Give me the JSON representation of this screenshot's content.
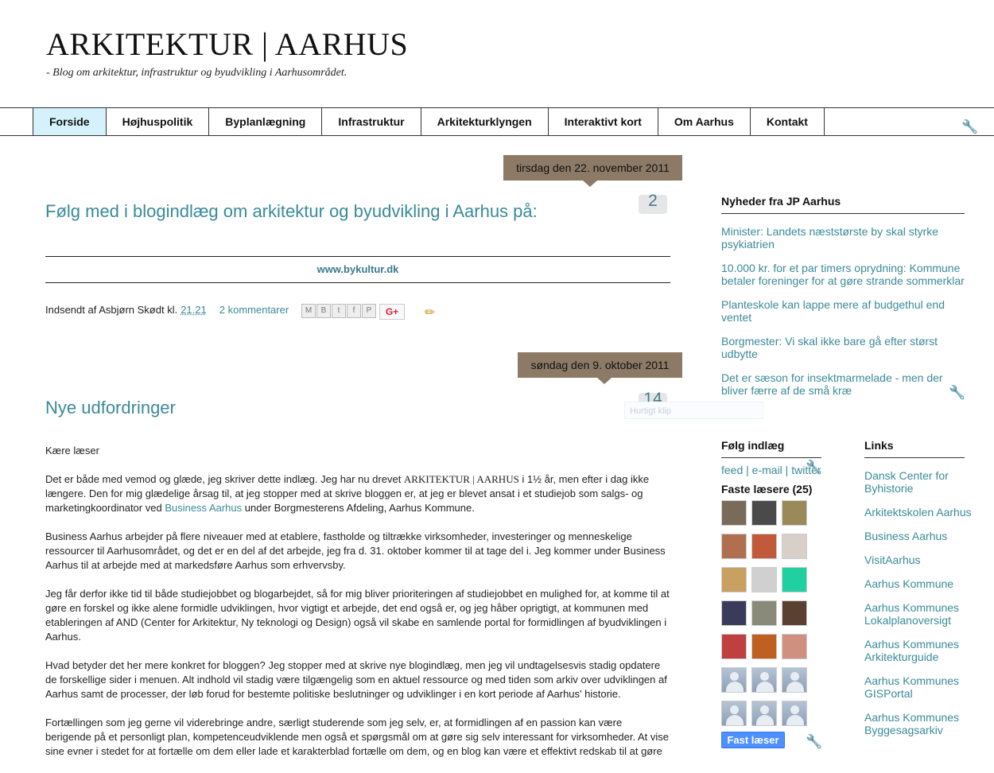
{
  "blog": {
    "title": "ARKITEKTUR | AARHUS",
    "description": "- Blog om arkitektur, infrastruktur og byudvikling i Aarhusområdet."
  },
  "nav": {
    "tabs": [
      "Forside",
      "Højhuspolitik",
      "Byplanlægning",
      "Infrastruktur",
      "Arkitekturklyngen",
      "Interaktivt kort",
      "Om Aarhus",
      "Kontakt"
    ],
    "active": "Forside"
  },
  "posts": [
    {
      "date": "tirsdag den 22. november 2011",
      "title": "Følg med i blogindlæg om arkitektur og byudvikling i Aarhus på:",
      "comment_count": "2",
      "link_text": "www.bykultur.dk",
      "author_prefix": "Indsendt af Asbjørn Skødt kl.",
      "time": "21.21",
      "comments_label": "2 kommentarer",
      "share_buttons": [
        "M",
        "B",
        "t",
        "f",
        "P"
      ],
      "gplus_label": "G+"
    },
    {
      "date": "søndag den 9. oktober 2011",
      "title": "Nye udfordringer",
      "comment_count": "14",
      "faint_label": "Hurtigt klip",
      "body": {
        "greeting": "Kære læser",
        "p1_a": "Det er både med vemod og glæde, jeg skriver dette indlæg. Jeg har nu drevet ",
        "p1_brand": "ARKITEKTUR | AARHUS",
        "p1_b": " i 1½ år, men efter i dag ikke længere. Den for mig glædelige årsag til, at jeg stopper med at skrive bloggen er, at jeg er blevet ansat i et studiejob som salgs- og marketingkoordinator ved ",
        "p1_link": "Business Aarhus",
        "p1_c": " under Borgmesterens Afdeling, Aarhus Kommune.",
        "p2": "Business Aarhus arbejder på flere niveauer med at etablere, fastholde og tiltrække virksomheder, investeringer og menneskelige ressourcer til Aarhusområdet, og det er en del af det arbejde, jeg fra d. 31. oktober kommer til at tage del i. Jeg kommer under Business Aarhus til at arbejde med at markedsføre Aarhus som erhvervsby.",
        "p3": "Jeg får derfor ikke tid til både studiejobbet og blogarbejdet, så for mig bliver prioriteringen af studiejobbet en mulighed for, at komme til at gøre en forskel og ikke alene formidle udviklingen, hvor vigtigt et arbejde, det end også er, og jeg håber oprigtigt, at kommunen med etableringen af AND (Center for Arkitektur, Ny teknologi og Design) også vil skabe en samlende portal for formidlingen af byudviklingen i Aarhus.",
        "p4": "Hvad betyder det her mere konkret for bloggen? Jeg stopper med at skrive nye blogindlæg, men jeg vil undtagelsesvis stadig opdatere de forskellige sider i menuen. Alt indhold vil stadig være tilgængelig som en aktuel ressource og med tiden som arkiv over udviklingen af Aarhus samt de processer, der løb forud for bestemte politiske beslutninger og udviklinger i en kort periode af Aarhus' historie.",
        "p5": "Fortællingen som jeg gerne vil viderebringe andre, særligt studerende som jeg selv, er, at formidlingen af en passion kan være berigende på et personligt plan, kompetenceudviklende men også et spørgsmål om at gøre sig selv interessant for virksomheder. At vise sine evner i stedet for at fortælle om dem eller lade et karakterblad fortælle om dem, og en blog kan være et effektivt redskab til at gøre"
      }
    }
  ],
  "sidebar": {
    "news": {
      "heading": "Nyheder fra JP Aarhus",
      "items": [
        "Minister: Landets næststørste by skal styrke psykiatrien",
        "10.000 kr. for et par timers oprydning: Kommune betaler foreninger for at gøre strande sommerklar",
        "Planteskole kan lappe mere af budgethul end ventet",
        "Borgmester: Vi skal ikke bare gå efter størst udbytte",
        "Det er sæson for insektmarmelade - men der bliver færre af de små kræ"
      ]
    },
    "follow": {
      "heading": "Følg indlæg",
      "feed": "feed",
      "email": "e-mail",
      "twitter": "twitter",
      "sep": " | ",
      "followers_label": "Faste læsere (25)",
      "join_label": "Fast læser",
      "avatar_colors": [
        "#7a6a5a",
        "#4a4a4a",
        "#9a8a5a",
        "#b07050",
        "#c05a3a",
        "#d8d0c8",
        "#c8a060",
        "#d0d0d0",
        "#20d0a0",
        "#3a3a5a",
        "#8a8a7a",
        "#5a4030",
        "#c04040",
        "#c06020",
        "#d09080"
      ]
    },
    "links": {
      "heading": "Links",
      "items": [
        "Dansk Center for Byhistorie",
        "Arkitektskolen Aarhus",
        "Business Aarhus",
        "VisitAarhus",
        "Aarhus Kommune",
        "Aarhus Kommunes Lokalplanoversigt",
        "Aarhus Kommunes Arkitekturguide",
        "Aarhus Kommunes GISPortal",
        "Aarhus Kommunes Byggesagsarkiv"
      ]
    }
  }
}
